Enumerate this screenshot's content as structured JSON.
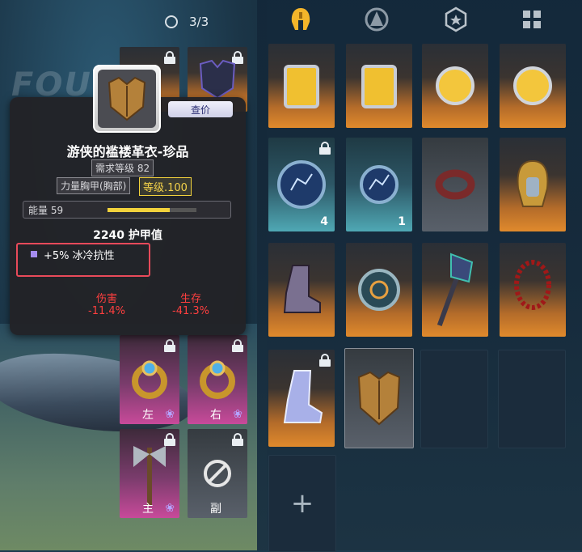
{
  "header": {
    "counter_text": "3/3",
    "tabs": [
      {
        "name": "helmet",
        "active": true
      },
      {
        "name": "skill",
        "active": false
      },
      {
        "name": "badge",
        "active": false
      },
      {
        "name": "grid",
        "active": false
      }
    ]
  },
  "background": {
    "faint_title": "FOU"
  },
  "tooltip": {
    "price_label": "查价",
    "item_name": "游侠的褴褛革衣-珍品",
    "requirement": "需求等级 82",
    "item_type": "力量胸甲(胸部)",
    "level_label": "等级.100",
    "energy_label": "能量 59",
    "energy_fraction": 0.7,
    "armor_text": "2240 护甲值",
    "affix_text": "+5% 冰冷抗性",
    "stats": [
      {
        "label": "伤害",
        "value": "-11.4%"
      },
      {
        "label": "生存",
        "value": "-41.3%"
      }
    ]
  },
  "equipment": {
    "hands": [
      "左",
      "右",
      "主",
      "副"
    ]
  },
  "inventory": {
    "counts": [
      "4",
      "1"
    ],
    "add_label": "+"
  },
  "colors": {
    "accent_gold": "#f2d23c",
    "damage_red": "#ff3f3f",
    "highlight_red": "#e84a5a"
  }
}
